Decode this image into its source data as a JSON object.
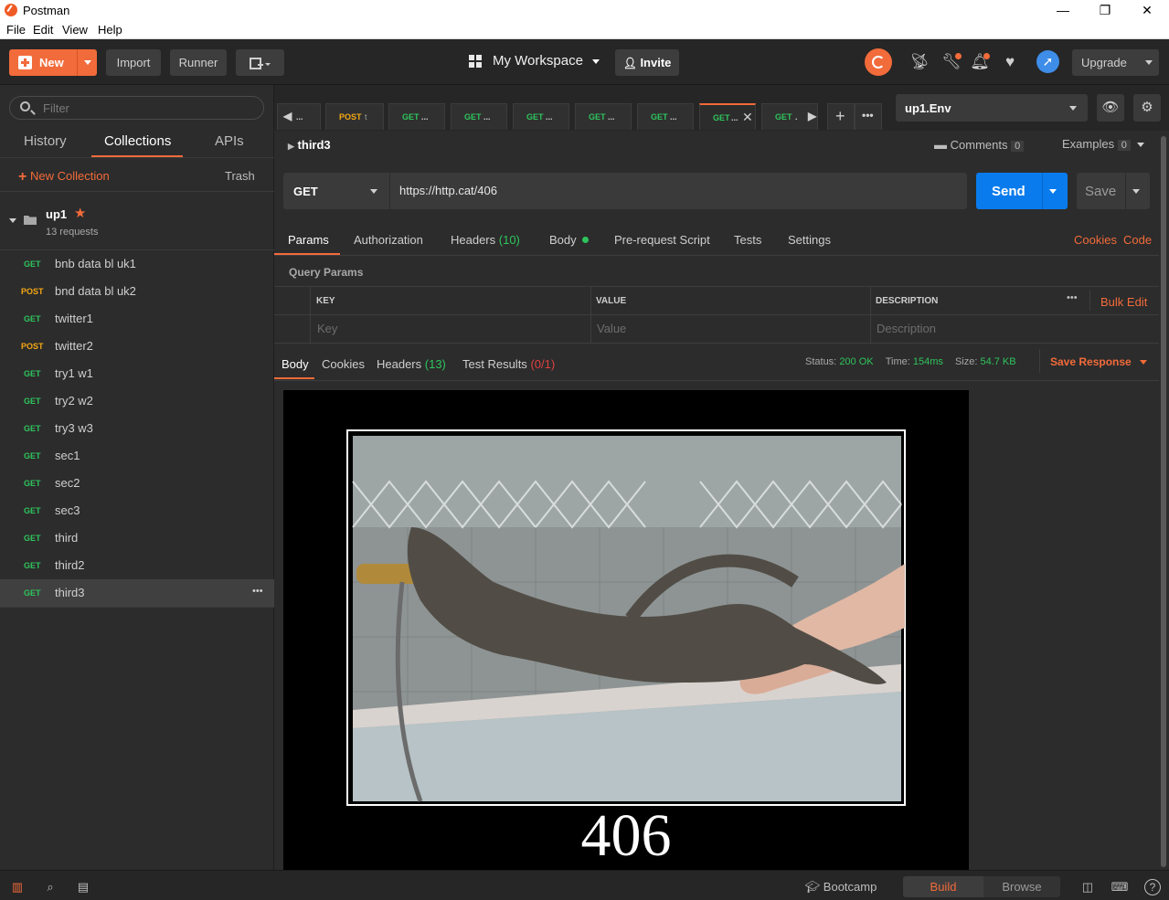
{
  "window": {
    "title": "Postman",
    "min": "—",
    "max": "❐",
    "close": "✕"
  },
  "menu": [
    "File",
    "Edit",
    "View",
    "Help"
  ],
  "header": {
    "new_label": "New",
    "import_label": "Import",
    "runner_label": "Runner",
    "workspace_label": "My Workspace",
    "invite_label": "Invite",
    "upgrade_label": "Upgrade"
  },
  "sidebar": {
    "filter_placeholder": "Filter",
    "tabs": [
      "History",
      "Collections",
      "APIs"
    ],
    "active_tab": "Collections",
    "new_collection": "New Collection",
    "trash": "Trash",
    "collection": {
      "name": "up1",
      "count": "13 requests"
    },
    "requests": [
      {
        "method": "GET",
        "name": "bnb data bl uk1"
      },
      {
        "method": "POST",
        "name": "bnd data bl uk2"
      },
      {
        "method": "GET",
        "name": "twitter1"
      },
      {
        "method": "POST",
        "name": "twitter2"
      },
      {
        "method": "GET",
        "name": "try1 w1"
      },
      {
        "method": "GET",
        "name": "try2 w2"
      },
      {
        "method": "GET",
        "name": "try3 w3"
      },
      {
        "method": "GET",
        "name": "sec1"
      },
      {
        "method": "GET",
        "name": "sec2"
      },
      {
        "method": "GET",
        "name": "sec3"
      },
      {
        "method": "GET",
        "name": "third"
      },
      {
        "method": "GET",
        "name": "third2"
      },
      {
        "method": "GET",
        "name": "third3"
      }
    ],
    "active_request": "third3",
    "more_icon": "•••"
  },
  "tabs": [
    {
      "method": "",
      "label": "..."
    },
    {
      "method": "POST",
      "label": "t"
    },
    {
      "method": "GET",
      "label": "..."
    },
    {
      "method": "GET",
      "label": "..."
    },
    {
      "method": "GET",
      "label": "..."
    },
    {
      "method": "GET",
      "label": "..."
    },
    {
      "method": "GET",
      "label": "..."
    },
    {
      "method": "GET",
      "label": "..."
    },
    {
      "method": "GET",
      "label": "."
    }
  ],
  "environment": {
    "selected": "up1.Env"
  },
  "request": {
    "name": "third3",
    "comments_label": "Comments",
    "comments_count": "0",
    "examples_label": "Examples",
    "examples_count": "0",
    "method": "GET",
    "url": "https://http.cat/406",
    "send_label": "Send",
    "save_label": "Save"
  },
  "request_tabs": {
    "params": "Params",
    "authorization": "Authorization",
    "headers": "Headers",
    "headers_count": "(10)",
    "body": "Body",
    "prerequest": "Pre-request Script",
    "tests": "Tests",
    "settings": "Settings",
    "cookies": "Cookies",
    "code": "Code"
  },
  "params": {
    "title": "Query Params",
    "col_key": "KEY",
    "col_value": "VALUE",
    "col_description": "DESCRIPTION",
    "bulk_edit": "Bulk Edit",
    "key_placeholder": "Key",
    "value_placeholder": "Value",
    "description_placeholder": "Description"
  },
  "response": {
    "tab_body": "Body",
    "tab_cookies": "Cookies",
    "tab_headers": "Headers",
    "headers_count": "(13)",
    "tab_tests": "Test Results",
    "tests_count": "(0/1)",
    "status_label": "Status:",
    "status_value": "200 OK",
    "time_label": "Time:",
    "time_value": "154ms",
    "size_label": "Size:",
    "size_value": "54.7 KB",
    "save_response": "Save Response",
    "image_caption": "406"
  },
  "footer": {
    "bootcamp": "Bootcamp",
    "build": "Build",
    "browse": "Browse",
    "help": "?"
  },
  "colors": {
    "accent": "#f26b3a",
    "get": "#2ec45c",
    "post": "#f4a814",
    "send": "#097bed",
    "error": "#e04040"
  }
}
